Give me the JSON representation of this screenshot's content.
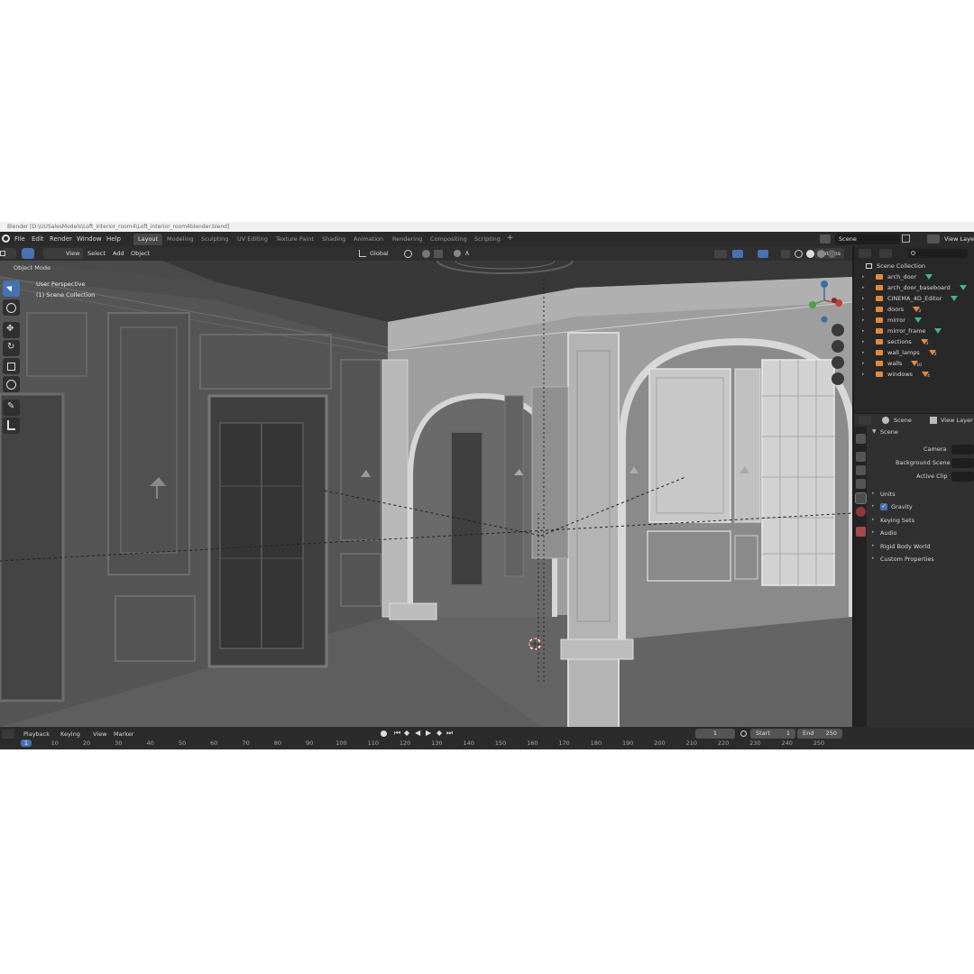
{
  "window": {
    "title": "Blender [D:\\UUSalesModels\\Loft_interior_room4\\Loft_interior_room4blender.blend]"
  },
  "menu": [
    "File",
    "Edit",
    "Render",
    "Window",
    "Help"
  ],
  "workspaces": [
    "Layout",
    "Modeling",
    "Sculpting",
    "UV Editing",
    "Texture Paint",
    "Shading",
    "Animation",
    "Rendering",
    "Compositing",
    "Scripting"
  ],
  "active_workspace": "Layout",
  "top_right": {
    "scene": "Scene",
    "view_layer": "View Layer"
  },
  "viewport_header": {
    "mode": "Object Mode",
    "menus": [
      "View",
      "Select",
      "Add",
      "Object"
    ],
    "orientation": "Global",
    "options": "Options"
  },
  "viewport_overlay": {
    "perspective": "User Perspective",
    "collection": "(1) Scene Collection"
  },
  "outliner": {
    "root": "Scene Collection",
    "items": [
      {
        "name": "arch_door",
        "badge": ""
      },
      {
        "name": "arch_door_baseboard",
        "badge": ""
      },
      {
        "name": "CINEMA_4D_Editor",
        "badge": ""
      },
      {
        "name": "doors",
        "badge": "3"
      },
      {
        "name": "mirror",
        "badge": ""
      },
      {
        "name": "mirror_frame",
        "badge": ""
      },
      {
        "name": "sections",
        "badge": "2"
      },
      {
        "name": "wall_lamps",
        "badge": "2"
      },
      {
        "name": "walls",
        "badge": "10"
      },
      {
        "name": "windows",
        "badge": "4"
      }
    ]
  },
  "properties": {
    "header_scene": "Scene",
    "header_view_layer": "View Layer",
    "panel": "Scene",
    "fields": [
      "Camera",
      "Background Scene",
      "Active Clip"
    ],
    "sections": [
      "Units",
      "Gravity",
      "Keying Sets",
      "Audio",
      "Rigid Body World",
      "Custom Properties"
    ],
    "gravity_checked": true
  },
  "timeline": {
    "menus": [
      "Playback",
      "Keying",
      "View",
      "Marker"
    ],
    "current_frame": "1",
    "start_label": "Start",
    "start": "1",
    "end_label": "End",
    "end": "250",
    "ruler": [
      "1",
      "10",
      "20",
      "30",
      "40",
      "50",
      "60",
      "70",
      "80",
      "90",
      "100",
      "110",
      "120",
      "130",
      "140",
      "150",
      "160",
      "170",
      "180",
      "190",
      "200",
      "210",
      "220",
      "230",
      "240",
      "250"
    ]
  },
  "colors": {
    "accent": "#4772b3",
    "outliner_collection_icon": "#e08a3c",
    "mesh_icon": "#3fb77a"
  },
  "icons": [
    "blender-logo-icon",
    "cursor-icon",
    "move-icon",
    "rotate-icon",
    "scale-icon",
    "transform-icon",
    "annotate-icon",
    "measure-icon",
    "zoom-icon",
    "hand-icon",
    "camera-icon",
    "grid-icon",
    "filter-icon",
    "play-icon"
  ]
}
